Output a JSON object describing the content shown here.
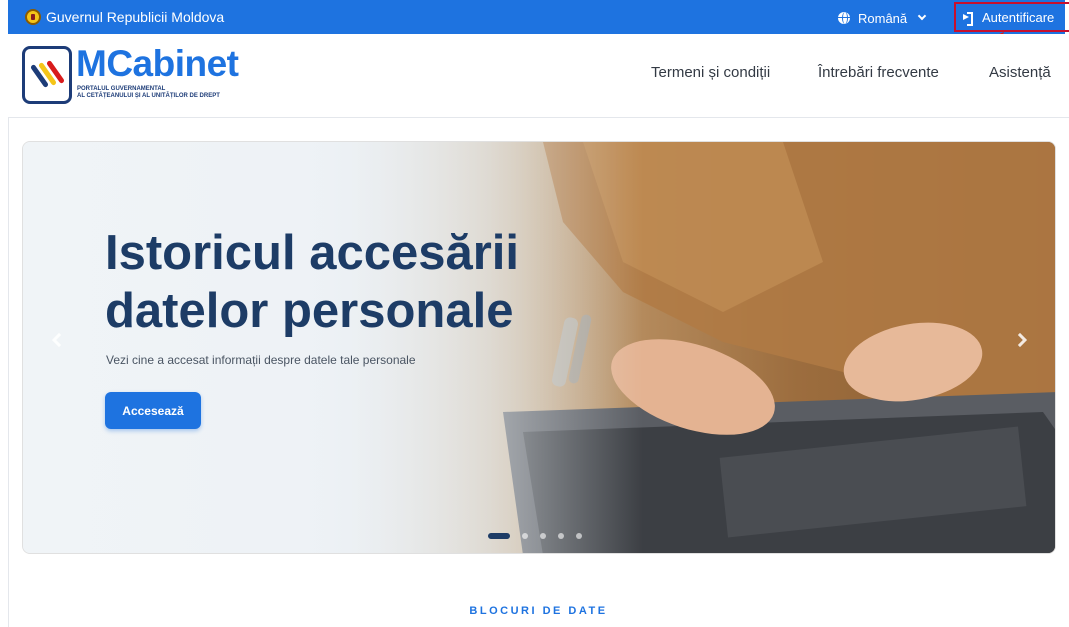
{
  "gov_bar": {
    "title": "Guvernul Republicii Moldova",
    "language": "Română",
    "login_label": "Autentificare"
  },
  "logo": {
    "name": "MCabinet",
    "subtitle_line1": "PORTALUL GUVERNAMENTAL",
    "subtitle_line2": "AL CETĂȚEANULUI ȘI AL UNITĂȚILOR DE DREPT"
  },
  "nav": {
    "items": [
      {
        "label": "Termeni și condiții"
      },
      {
        "label": "Întrebări frecvente"
      },
      {
        "label": "Asistență"
      }
    ]
  },
  "hero": {
    "title": "Istoricul accesării datelor personale",
    "subtitle": "Vezi cine a accesat informații despre datele tale personale",
    "cta_label": "Accesează",
    "slide_count": 5,
    "active_slide": 1
  },
  "section": {
    "label": "BLOCURI DE DATE"
  },
  "colors": {
    "primary": "#1e73e0",
    "navy": "#1d3c66",
    "highlight": "#c8102e"
  }
}
